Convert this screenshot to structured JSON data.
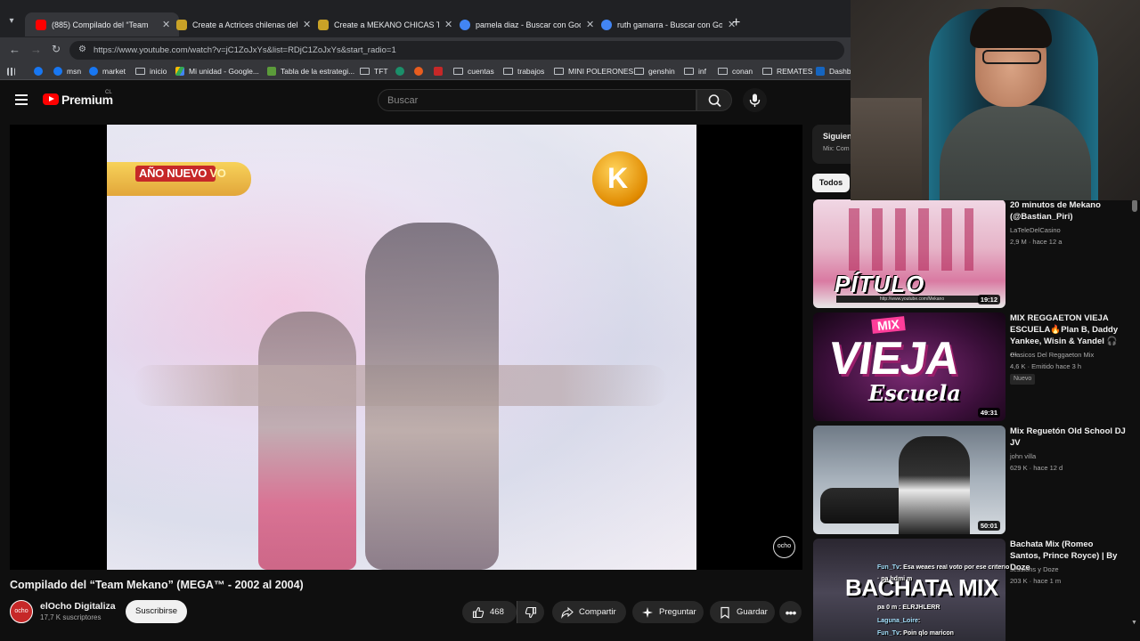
{
  "browser": {
    "tabs": [
      {
        "title": "(885) Compilado del “Team",
        "favicon_color": "#ff0000",
        "active": true
      },
      {
        "title": "Create a Actrices chilenas del M",
        "favicon_color": "#c9a227",
        "active": false
      },
      {
        "title": "Create a MEKANO CHICAS Tie",
        "favicon_color": "#c9a227",
        "active": false
      },
      {
        "title": "pamela diaz - Buscar con Goog",
        "favicon_color": "#4285f4",
        "active": false
      },
      {
        "title": "ruth gamarra - Buscar con Goo",
        "favicon_color": "#4285f4",
        "active": false
      }
    ],
    "url": "https://www.youtube.com/watch?v=jC1ZoJxYs&list=RDjC1ZoJxYs&start_radio=1",
    "bookmarks": [
      {
        "label": "",
        "icon": "facebook-icon",
        "color": "#1877f2"
      },
      {
        "label": "msn",
        "icon": "facebook-icon",
        "color": "#1877f2"
      },
      {
        "label": "market",
        "icon": "facebook-icon",
        "color": "#1877f2"
      },
      {
        "label": "inicio",
        "icon": "folder-icon",
        "color": ""
      },
      {
        "label": "Mi unidad - Google...",
        "icon": "drive-icon",
        "color": "#34a853"
      },
      {
        "label": "Tabla de la estrategi...",
        "icon": "sheet-icon",
        "color": "#5b9b3a"
      },
      {
        "label": "TFT",
        "icon": "folder-icon",
        "color": ""
      },
      {
        "label": "",
        "icon": "app-icon",
        "color": "#1b8f6a"
      },
      {
        "label": "",
        "icon": "app-icon",
        "color": "#e85d1f"
      },
      {
        "label": "",
        "icon": "app-icon",
        "color": "#c62828"
      },
      {
        "label": "cuentas",
        "icon": "folder-icon",
        "color": ""
      },
      {
        "label": "trabajos",
        "icon": "folder-icon",
        "color": ""
      },
      {
        "label": "MINI POLERONES",
        "icon": "folder-icon",
        "color": ""
      },
      {
        "label": "genshin",
        "icon": "folder-icon",
        "color": ""
      },
      {
        "label": "inf",
        "icon": "folder-icon",
        "color": ""
      },
      {
        "label": "conan",
        "icon": "folder-icon",
        "color": ""
      },
      {
        "label": "REMATES",
        "icon": "folder-icon",
        "color": ""
      },
      {
        "label": "Dashbo",
        "icon": "app-icon",
        "color": "#1565c0"
      }
    ]
  },
  "youtube": {
    "logo_text": "Premium",
    "country_code": "CL",
    "search_placeholder": "Buscar"
  },
  "video": {
    "banner_text": "AÑO NUEVO",
    "banner_suffix": "VO",
    "corner_logo_letter": "K",
    "watermark": "ocho",
    "title": "Compilado del “Team Mekano” (MEGA™ - 2002 al 2004)",
    "channel": "elOcho Digitaliza",
    "channel_avatar_text": "ocho",
    "subscribers": "17,7 K suscriptores",
    "subscribe_label": "Suscribirse",
    "likes": "468",
    "share_label": "Compartir",
    "ask_label": "Preguntar",
    "save_label": "Guardar"
  },
  "sidebar": {
    "up_next_label": "Siguien",
    "up_next_sub": "Mix: Com",
    "chip_label": "Todos",
    "recommendations": [
      {
        "title": "20 minutos de Mekano (@Bastian_Piri)",
        "channel": "LaTeleDelCasino",
        "meta": "2,9 M  ·  hace 12 a",
        "duration": "19:12",
        "thumb_text": "PÍTULO",
        "thumb_sub": "http://www.youtube.com/Mekano",
        "badge": ""
      },
      {
        "title": "MIX REGGAETON VIEJA ESCUELA🔥Plan B, Daddy Yankee, Wisin & Yandel 🎧 ...",
        "channel": "Clasicos Del Reggaeton Mix",
        "meta": "4,6 K  ·  Emitido hace 3 h",
        "duration": "49:31",
        "thumb_text": "VIEJA",
        "thumb_top": "MIX",
        "thumb_sub": "Escuela",
        "badge": "Nuevo"
      },
      {
        "title": "Mix Reguetón Old School DJ JV",
        "channel": "john villa",
        "meta": "629 K  ·  hace 12 d",
        "duration": "50:01",
        "badge": ""
      },
      {
        "title": "Bachata Mix (Romeo Santos, Prince Royce) | By Doze",
        "channel": "sessions y Doze",
        "meta": "203 K  ·  hace 1 m",
        "duration": "",
        "thumb_text": "BACHATA MIX",
        "badge": ""
      }
    ]
  },
  "stream_chat": [
    {
      "user": "Fun_Tv",
      "text": ": Esa weaes real voto por ese criterio"
    },
    {
      "user": "",
      "text": "   ·  pa  hdmi  m"
    },
    {
      "user": "",
      "text": "   pa  0  m : ELRJHLERR"
    },
    {
      "user": "Laguna_Loire",
      "text": ":"
    },
    {
      "user": "Fun_Tv",
      "text": ": Poin qlo maricon"
    }
  ],
  "colors": {
    "background": "#0f0f0f",
    "accent_red": "#ff0000",
    "text_primary": "#f1f1f1",
    "text_secondary": "#aaaaaa"
  }
}
